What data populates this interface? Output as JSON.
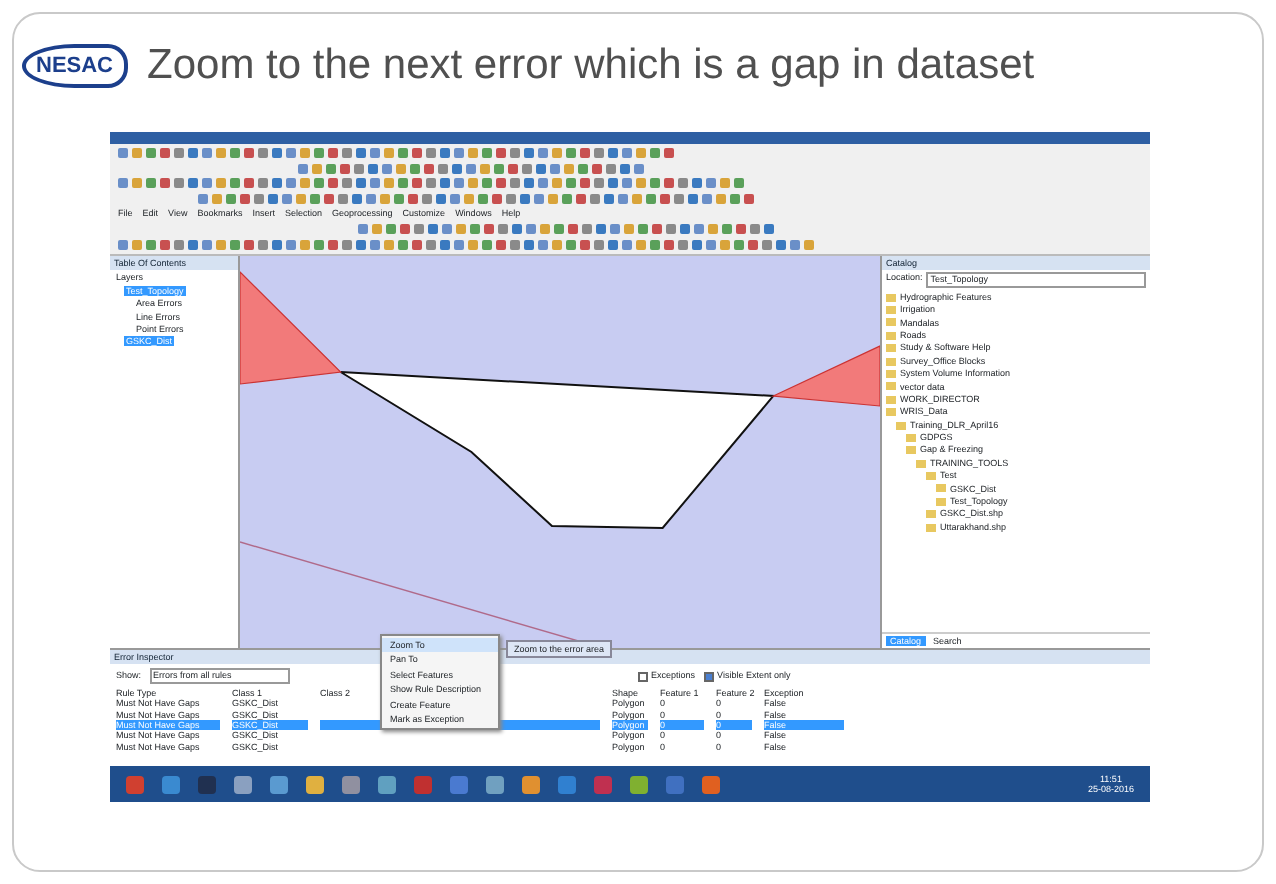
{
  "slide": {
    "logo": "NESAC",
    "title": "Zoom to the next error which is a gap in dataset"
  },
  "app": {
    "menu": [
      "File",
      "Edit",
      "View",
      "Bookmarks",
      "Insert",
      "Selection",
      "Geoprocessing",
      "Customize",
      "Windows",
      "Help"
    ],
    "toc": {
      "title": "Table Of Contents",
      "tree": [
        {
          "label": "Layers",
          "selected": false,
          "children": [
            {
              "label": "Test_Topology",
              "selected": true,
              "children": [
                {
                  "label": "Area Errors",
                  "selected": false
                },
                {
                  "label": "Line Errors",
                  "selected": false
                },
                {
                  "label": "Point Errors",
                  "selected": false
                }
              ]
            },
            {
              "label": "GSKC_Dist",
              "selected": true
            }
          ]
        }
      ]
    },
    "catalog": {
      "title": "Catalog",
      "location_label": "Location:",
      "location": "Test_Topology",
      "tree": [
        {
          "label": "Hydrographic Features"
        },
        {
          "label": "Irrigation"
        },
        {
          "label": "Mandalas"
        },
        {
          "label": "Roads"
        },
        {
          "label": "Study & Software Help"
        },
        {
          "label": "Survey_Office Blocks"
        },
        {
          "label": "System Volume Information"
        },
        {
          "label": "vector data"
        },
        {
          "label": "WORK_DIRECTOR"
        },
        {
          "label": "WRIS_Data",
          "children": [
            {
              "label": "Training_DLR_April16",
              "children": [
                {
                  "label": "GDPGS"
                },
                {
                  "label": "Gap & Freezing",
                  "children": [
                    {
                      "label": "TRAINING_TOOLS",
                      "children": [
                        {
                          "label": "Test",
                          "children": [
                            {
                              "label": "GSKC_Dist"
                            },
                            {
                              "label": "Test_Topology"
                            }
                          ]
                        },
                        {
                          "label": "GSKC_Dist.shp"
                        },
                        {
                          "label": "Uttarakhand.shp"
                        }
                      ]
                    }
                  ]
                }
              ]
            }
          ]
        }
      ],
      "tabs": [
        {
          "label": "Catalog",
          "selected": true
        },
        {
          "label": "Search",
          "selected": false
        }
      ]
    },
    "error_inspector": {
      "title": "Error Inspector",
      "show_label": "Show:",
      "show_value": "Errors from all rules",
      "exceptions": {
        "label": "Exceptions",
        "checked": false
      },
      "visible_extent": {
        "label": "Visible Extent only",
        "checked": true
      },
      "columns": [
        "Rule Type",
        "Class 1",
        "Class 2",
        "Shape",
        "Feature 1",
        "Feature 2",
        "Exception"
      ],
      "rows": [
        {
          "cells": [
            "Must Not Have Gaps",
            "GSKC_Dist",
            "",
            "Polygon",
            "0",
            "0",
            "False"
          ],
          "selected": false
        },
        {
          "cells": [
            "Must Not Have Gaps",
            "GSKC_Dist",
            "",
            "Polygon",
            "0",
            "0",
            "False"
          ],
          "selected": false
        },
        {
          "cells": [
            "Must Not Have Gaps",
            "GSKC_Dist",
            "",
            "Polygon",
            "0",
            "0",
            "False"
          ],
          "selected": true
        },
        {
          "cells": [
            "Must Not Have Gaps",
            "GSKC_Dist",
            "",
            "Polygon",
            "0",
            "0",
            "False"
          ],
          "selected": false
        },
        {
          "cells": [
            "Must Not Have Gaps",
            "GSKC_Dist",
            "",
            "Polygon",
            "0",
            "0",
            "False"
          ],
          "selected": false
        }
      ]
    },
    "context_menu": {
      "items": [
        {
          "label": "Zoom To",
          "selected": true
        },
        {
          "label": "Pan To",
          "selected": false
        },
        {
          "label": "Select Features",
          "selected": false
        },
        {
          "label": "Show Rule Description",
          "selected": false
        },
        {
          "label": "Create Feature",
          "selected": false
        },
        {
          "label": "Mark as Exception",
          "selected": false
        }
      ],
      "tooltip": "Zoom to the error area"
    },
    "taskbar": {
      "time": "11:51",
      "date": "25-08-2016"
    }
  }
}
